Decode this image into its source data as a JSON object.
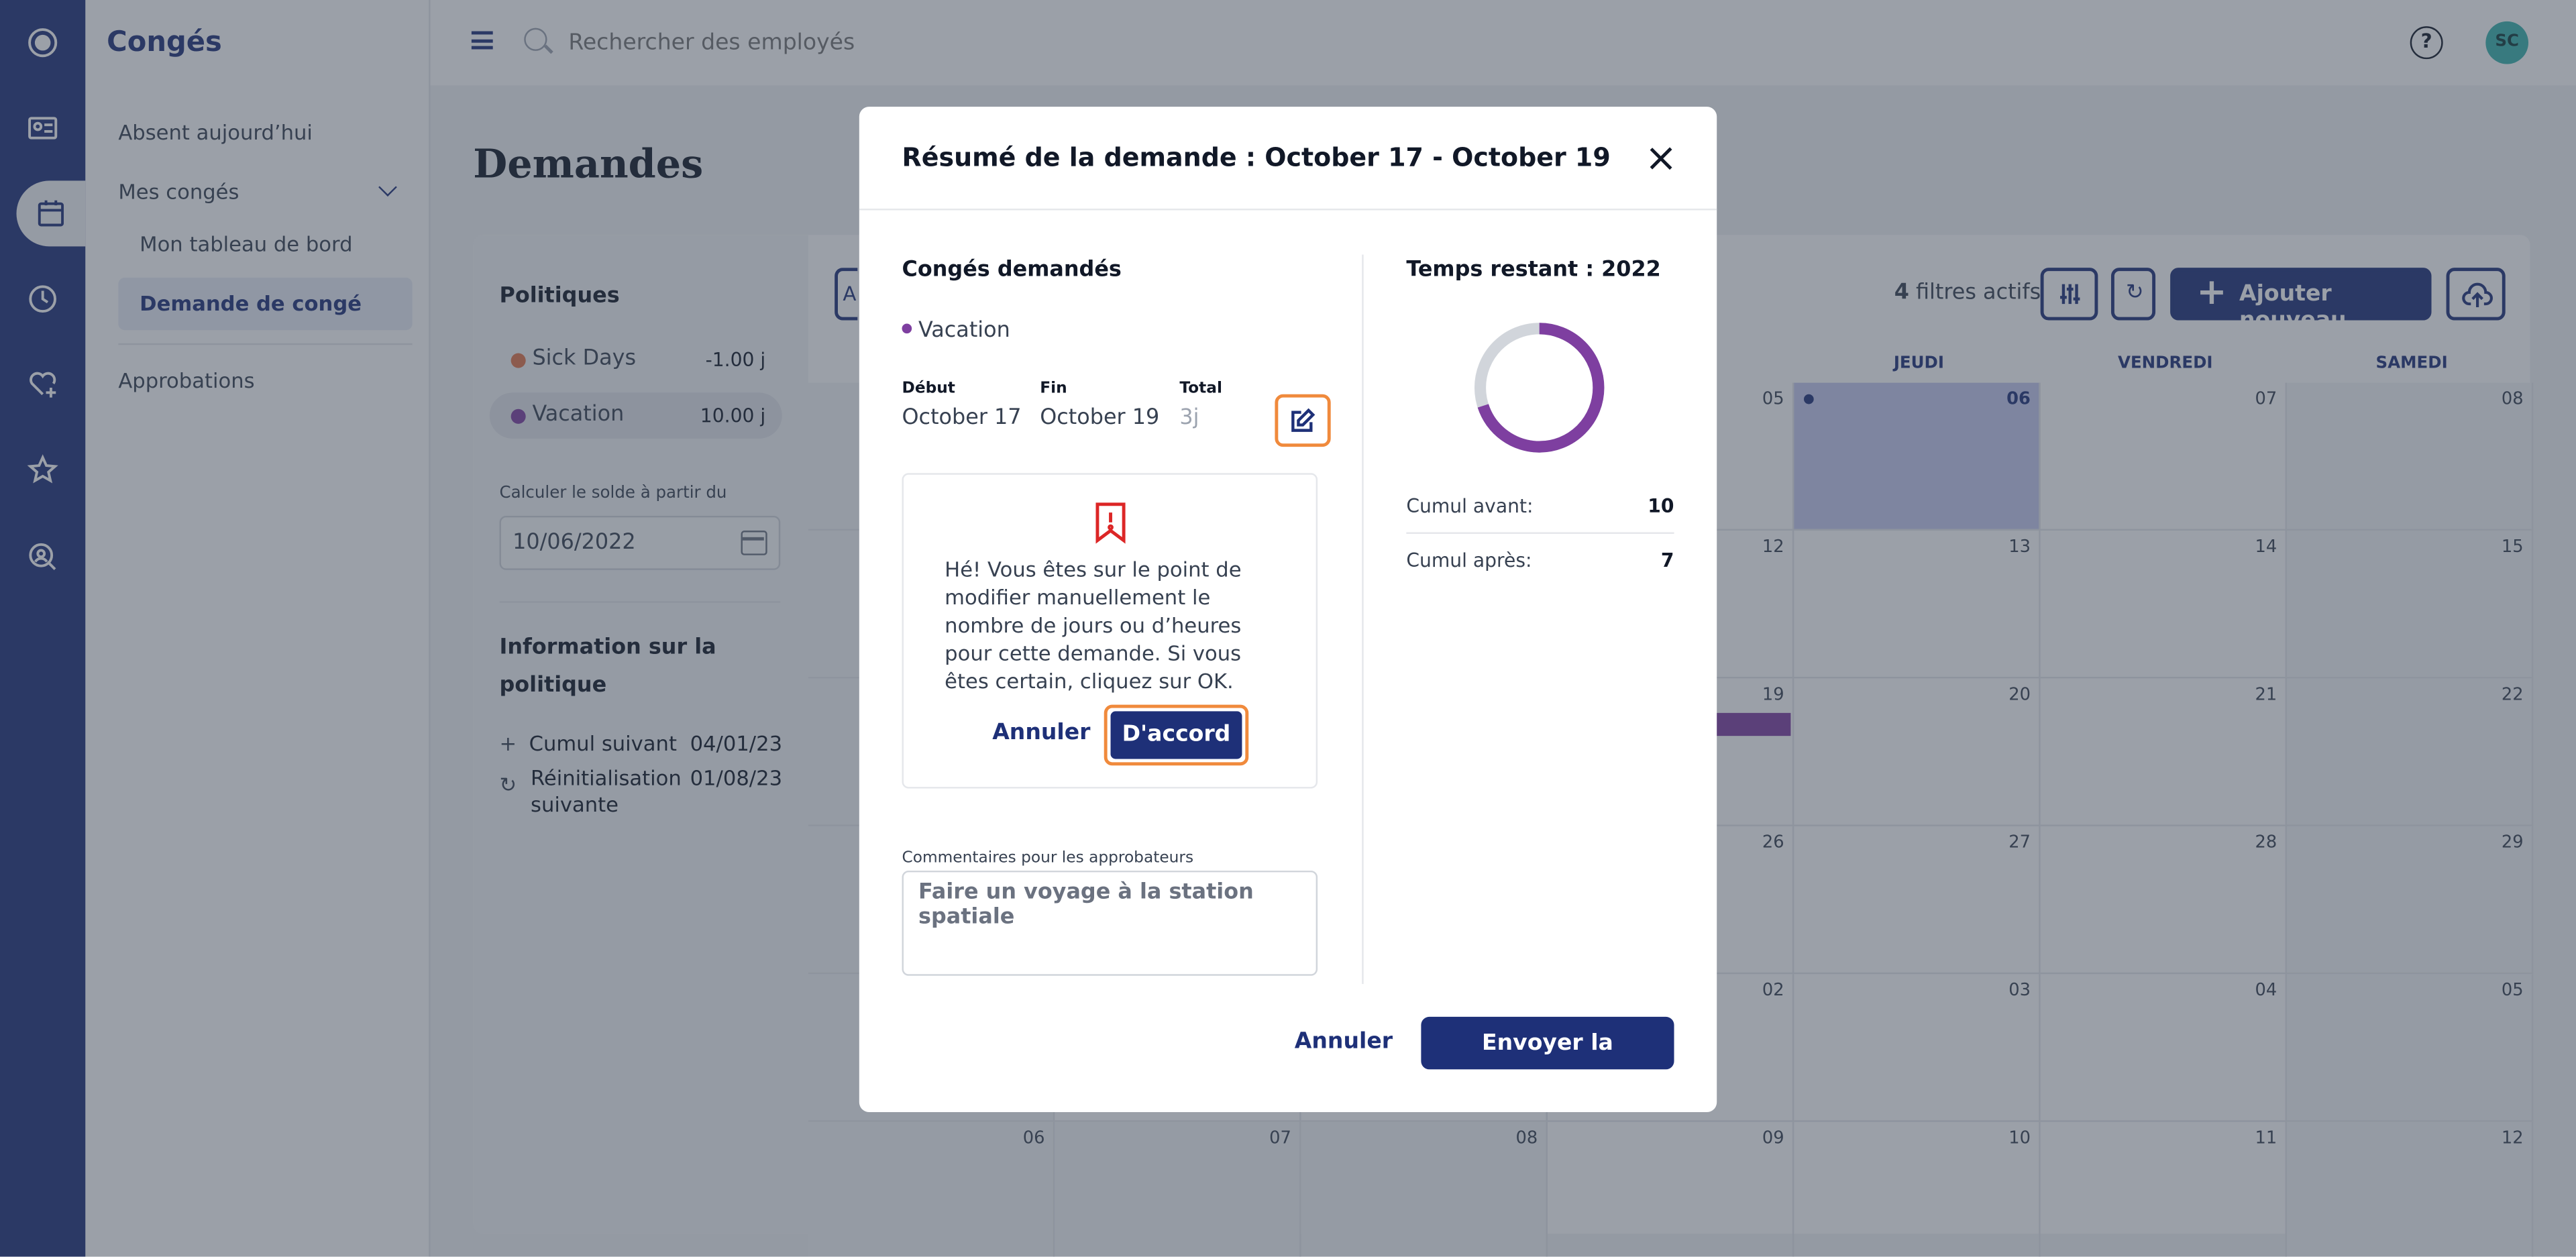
{
  "app": {
    "title": "Congés"
  },
  "sidebar": {
    "absent_today": "Absent aujourd’hui",
    "my_leave": "Mes congés",
    "dashboard": "Mon tableau de bord",
    "leave_request": "Demande de congé",
    "approvals": "Approbations"
  },
  "topbar": {
    "search_placeholder": "Rechercher des employés",
    "help": "?",
    "avatar_initials": "SC"
  },
  "page": {
    "title": "Demandes"
  },
  "policies": {
    "title": "Politiques",
    "items": [
      {
        "name": "Sick Days",
        "value": "-1.00 j",
        "color": "#e0744a"
      },
      {
        "name": "Vacation",
        "value": "10.00 j",
        "color": "#7e3fa0"
      }
    ],
    "calc_label": "Calculer le solde à partir du",
    "calc_date": "10/06/2022",
    "info_title": "Information sur la politique",
    "info": [
      {
        "symbol": "+",
        "label": "Cumul suivant",
        "date": "04/01/23"
      },
      {
        "symbol": "↻",
        "label": "Réinitialisation suivante",
        "date": "01/08/23"
      }
    ]
  },
  "toolbar": {
    "filters_count": "4",
    "filters_label": "filtres actifs",
    "add_new": "Ajouter nouveau",
    "partial_left": "A"
  },
  "calendar": {
    "weekdays": [
      "JEUDI",
      "VENDREDI",
      "SAMEDI"
    ],
    "rows": [
      [
        "",
        "",
        "",
        "05",
        "06",
        "07",
        "08"
      ],
      [
        "",
        "",
        "",
        "12",
        "13",
        "14",
        "15"
      ],
      [
        "",
        "",
        "",
        "19",
        "20",
        "21",
        "22"
      ],
      [
        "",
        "",
        "",
        "26",
        "27",
        "28",
        "29"
      ],
      [
        "",
        "",
        "",
        "02",
        "03",
        "04",
        "05"
      ],
      [
        "06",
        "07",
        "08",
        "09",
        "10",
        "11",
        "12"
      ]
    ]
  },
  "modal": {
    "title": "Résumé de la demande : October 17 - October 19",
    "requested_title": "Congés demandés",
    "leave_type": "Vacation",
    "start_label": "Début",
    "start_value": "October 17",
    "end_label": "Fin",
    "end_value": "October 19",
    "total_label": "Total",
    "total_value": "3j",
    "warning_text": "Hé! Vous êtes sur le point de modifier manuellement le nombre de jours ou d’heures pour cette demande. Si vous êtes certain, cliquez sur OK.",
    "warning_cancel": "Annuler",
    "warning_ok": "D'accord",
    "comments_label": "Commentaires pour les approbateurs",
    "comments_value": "Faire un voyage à la station spatiale",
    "remaining_title": "Temps restant : 2022",
    "cumul_before_label": "Cumul avant:",
    "cumul_before_value": "10",
    "cumul_after_label": "Cumul après:",
    "cumul_after_value": "7",
    "cancel": "Annuler",
    "submit": "Envoyer la demande",
    "donut": {
      "used_fraction": 0.7,
      "used_color": "#7e3fa0",
      "rest_color": "#d1d5db"
    }
  }
}
